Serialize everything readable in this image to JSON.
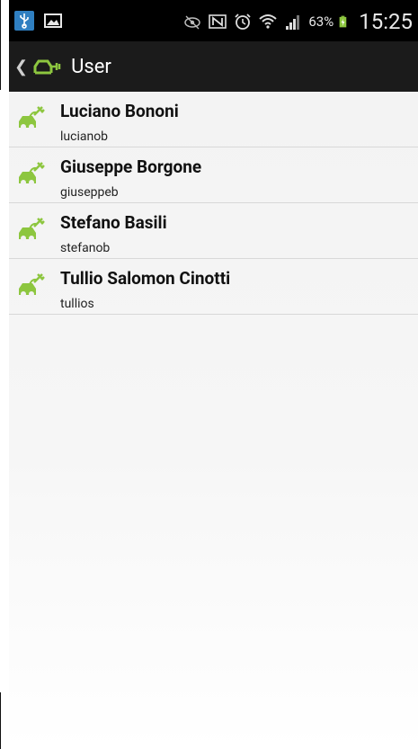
{
  "statusbar": {
    "battery_percent": "63%",
    "time": "15:25",
    "icons": [
      "usb-icon",
      "gallery-icon",
      "eye-icon",
      "nfc-icon",
      "alarm-icon",
      "wifi-icon",
      "signal-icon",
      "battery-charging-icon"
    ]
  },
  "actionbar": {
    "title": "User",
    "icon": "car-plug-icon"
  },
  "users": [
    {
      "name": "Luciano Bononi",
      "username": "lucianob"
    },
    {
      "name": "Giuseppe Borgone",
      "username": "giuseppeb"
    },
    {
      "name": "Stefano Basili",
      "username": "stefanob"
    },
    {
      "name": "Tullio Salomon Cinotti",
      "username": "tullios"
    }
  ],
  "colors": {
    "accent_green": "#8dc63f",
    "statusbar_bg": "#000000",
    "actionbar_bg": "#1b1b1b",
    "usb_blue": "#2f7fc1"
  }
}
